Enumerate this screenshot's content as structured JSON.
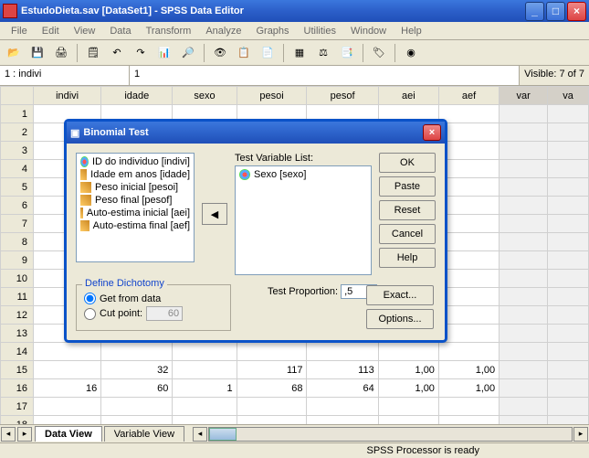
{
  "window": {
    "title": "EstudoDieta.sav [DataSet1] - SPSS Data Editor"
  },
  "menu": [
    "File",
    "Edit",
    "View",
    "Data",
    "Transform",
    "Analyze",
    "Graphs",
    "Utilities",
    "Window",
    "Help"
  ],
  "cellref": {
    "addr": "1 : indivi",
    "val": "1",
    "visible": "Visible: 7 of 7"
  },
  "columns": [
    "indivi",
    "idade",
    "sexo",
    "pesoi",
    "pesof",
    "aei",
    "aef",
    "var",
    "va"
  ],
  "rows_visible": 18,
  "data_rows": {
    "15": [
      "",
      "32",
      "",
      "117",
      "113",
      "1,00",
      "1,00"
    ],
    "16": [
      "16",
      "60",
      "1",
      "68",
      "64",
      "1,00",
      "1,00"
    ]
  },
  "tabs": {
    "active": "Data View",
    "inactive": "Variable View"
  },
  "status": "SPSS Processor is ready",
  "dialog": {
    "title": "Binomial Test",
    "vars": [
      {
        "icon": "nom",
        "label": "ID do individuo [indivi]"
      },
      {
        "icon": "ruler",
        "label": "Idade em anos [idade]"
      },
      {
        "icon": "ruler",
        "label": "Peso inicial [pesoi]"
      },
      {
        "icon": "ruler",
        "label": "Peso final [pesof]"
      },
      {
        "icon": "ruler",
        "label": "Auto-estima inicial [aei]"
      },
      {
        "icon": "ruler",
        "label": "Auto-estima final [aef]"
      }
    ],
    "test_var_label": "Test Variable List:",
    "test_vars": [
      {
        "icon": "nom",
        "label": "Sexo [sexo]"
      }
    ],
    "buttons": {
      "ok": "OK",
      "paste": "Paste",
      "reset": "Reset",
      "cancel": "Cancel",
      "help": "Help",
      "exact": "Exact...",
      "options": "Options..."
    },
    "dichotomy": {
      "title": "Define Dichotomy",
      "get": "Get from data",
      "cut": "Cut point:",
      "cutval": "60"
    },
    "test_prop_label": "Test Proportion:",
    "test_prop": ",5",
    "move": "◀"
  }
}
